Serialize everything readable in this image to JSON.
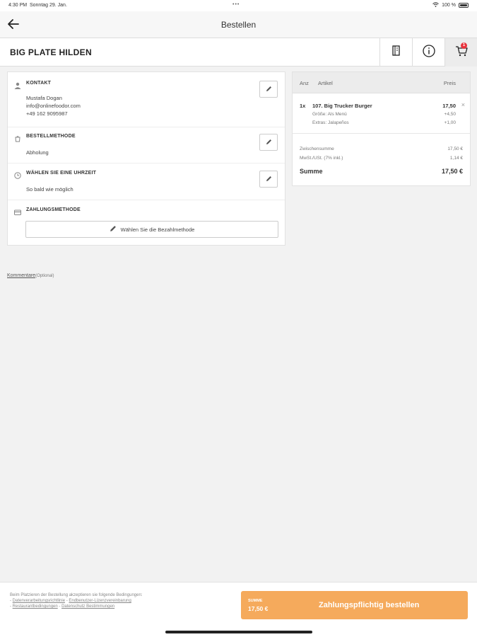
{
  "status": {
    "time": "4:30 PM",
    "date": "Sonntag 29. Jan.",
    "battery": "100 %"
  },
  "nav": {
    "title": "Bestellen"
  },
  "restaurant": {
    "name": "BIG PLATE HILDEN",
    "cart_count": "1"
  },
  "contact": {
    "title": "KONTAKT",
    "name": "Mustafa Dogan",
    "email": "info@onlinefoodor.com",
    "phone": "+49 162 9095987"
  },
  "order_method": {
    "title": "BESTELLMETHODE",
    "value": "Abholung"
  },
  "time_choice": {
    "title": "WÄHLEN SIE EINE UHRZEIT",
    "value": "So bald wie möglich"
  },
  "payment": {
    "title": "ZAHLUNGSMETHODE",
    "button": "Wählen Sie die Bezahlmethode"
  },
  "comment": {
    "link": "Kommentare",
    "optional": "Optional"
  },
  "cart": {
    "headers": {
      "qty": "Anz",
      "article": "Artikel",
      "price": "Preis"
    },
    "item": {
      "qty": "1x",
      "name": "107. Big Trucker Burger",
      "price": "17,50",
      "options": [
        {
          "label": "Größe: Als Menü",
          "price": "+4,50"
        },
        {
          "label": "Extras: Jalapeños",
          "price": "+1,00"
        }
      ]
    },
    "subtotal_label": "Zwischensumme",
    "subtotal": "17,50 €",
    "vat_label": "MwSt./USt. (7% inkl.)",
    "vat": "1,14 €",
    "total_label": "Summe",
    "total": "17,50 €"
  },
  "footer": {
    "terms_intro": "Beim Platzieren der Bestellung akzeptieren sie folgende Bedingungen:",
    "terms_1": "Datenverarbeitungsrichtlinie",
    "terms_2": "Endbenutzer-Lizenzvereinbarung",
    "terms_3": "Restaurantbedingungen",
    "terms_4": "Datenschutz Bestimmungen",
    "sum_label": "SUMME",
    "sum_value": "17,50 €",
    "cta": "Zahlungspflichtig bestellen",
    "accent": "#f5aa5c"
  }
}
